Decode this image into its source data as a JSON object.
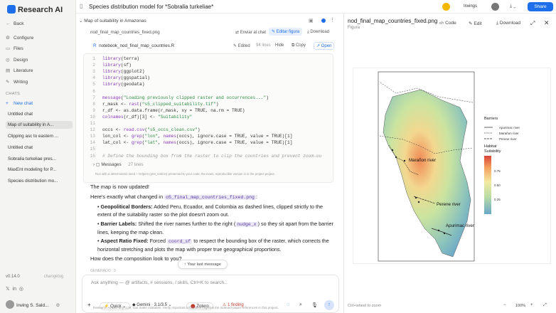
{
  "app": {
    "name": "Research AI",
    "title": "Species distribution model for *Sobralia turkeliae*",
    "user_name": "Irwings",
    "user_full": "Irwing S. Sald...",
    "version": "v0.14.0",
    "changelog": "changelog"
  },
  "sidebar": {
    "back": "Back",
    "items": [
      "Configure",
      "Files",
      "Design",
      "Literature",
      "Writing"
    ],
    "chats_header": "CHATS",
    "new_chat": "New chat",
    "chats": [
      "Untitled chat",
      "Map of suitability in A...",
      "Clipping asc to eastern ...",
      "Untitled chat",
      "Sobralia turkeliae pres...",
      "MaxEnt modeling for P...",
      "Species distribution mo..."
    ]
  },
  "panel": {
    "breadcrumb": "Map of suitability in Amazonas",
    "file1": "nod_final_map_countries_fixed.png",
    "send_to_chat": "Enviar al chat",
    "edit_figure": "Editar figura",
    "download": "Download",
    "script_name": "notebook_nod_final_map_countries.R",
    "edited": "Edited",
    "lines": "94 lines",
    "hide": "Hide",
    "copy": "Copy",
    "open": "Open",
    "code_lines": [
      [
        "1",
        "library(terra)"
      ],
      [
        "2",
        "library(sf)"
      ],
      [
        "3",
        "library(ggplot2)"
      ],
      [
        "4",
        "library(ggspatial)"
      ],
      [
        "5",
        "library(geodata)"
      ],
      [
        "6",
        ""
      ],
      [
        "7",
        "message(\"Loading previously clipped raster and occurrences...\")"
      ],
      [
        "8",
        "r_mask <- rast(\"s5_clipped_suitability.tif\")"
      ],
      [
        "9",
        "r_df <- as.data.frame(r_mask, xy = TRUE, na.rm = TRUE)"
      ],
      [
        "10",
        "colnames(r_df)[3] <- \"Suitability\""
      ],
      [
        "11",
        ""
      ],
      [
        "12",
        "occs <- read.csv(\"s5_occs_clean.csv\")"
      ],
      [
        "13",
        "lon_col <- grep(\"lon\", names(occs), ignore.case = TRUE, value = TRUE)[1]"
      ],
      [
        "14",
        "lat_col <- grep(\"lat\", names(occs), ignore.case = TRUE, value = TRUE)[1]"
      ],
      [
        "15",
        ""
      ],
      [
        "16",
        "# Define the bounding box from the raster to clip the countries and prevent zoom-ou"
      ]
    ],
    "messages_label": "Messages",
    "messages_count": "27 lines",
    "run_note": "Run with a deterministic seed + helpers (plot_restrict) preserved to your code; the exact, reproducible version is in the project project.",
    "msg1": "The map is now updated!",
    "msg2a": "Here's exactly what changed in ",
    "msg2file": "o5_final_map_countries_fixed.png",
    "msg2b": ":",
    "b1t": "Geopolitical Borders:",
    "b1": " Added Peru, Ecuador, and Colombia as dashed lines, clipped strictly to the extent of the suitability raster so the plot doesn't zoom out.",
    "b2t": "Barrier Labels:",
    "b2a": " Shifted the river names further to the right (",
    "b2code": "nudge_x",
    "b2b": ") so they sit apart from the barrier lines, keeping the map clean.",
    "b3t": "Aspect Ratio Fixed:",
    "b3a": " Forced ",
    "b3code": "coord_sf",
    "b3b": " to respect the bounding box of the raster, which corrects the horizontal stretching and plots the map with proper true geographical proportions.",
    "q": "How does the composition look to you?",
    "last_message": "Your last message",
    "generated": "GENERADO · 3"
  },
  "input": {
    "placeholder": "Ask anything — @ artifacts, # sessions, / skills, Ctrl+K to search...",
    "quick": "Quick",
    "model": "Gemini · 3.1/3.5",
    "zotero": "Zotero",
    "finding": "1 finding",
    "disclaimer": "Research AI, like any LLM, can make mistakes. Verify important information against the indexed-paper references in this project."
  },
  "viewer": {
    "file": "nod_final_map_countries_fixed.png",
    "kind": "Figura",
    "code": "Code",
    "edit": "Edit",
    "download": "Download",
    "share": "Share",
    "zoom_hint": "Ctrl+wheel to zoom",
    "zoom": "100%"
  },
  "legend": {
    "barriers": "Barriers",
    "items": [
      "Apurimac river",
      "Marañon river",
      "Perene river"
    ],
    "habitat": "Habitat\nSuitability",
    "ticks": [
      "0.75",
      "0.50",
      "0.25"
    ]
  },
  "map_labels": [
    "Marañon river",
    "Perene river",
    "Apurimac river"
  ]
}
